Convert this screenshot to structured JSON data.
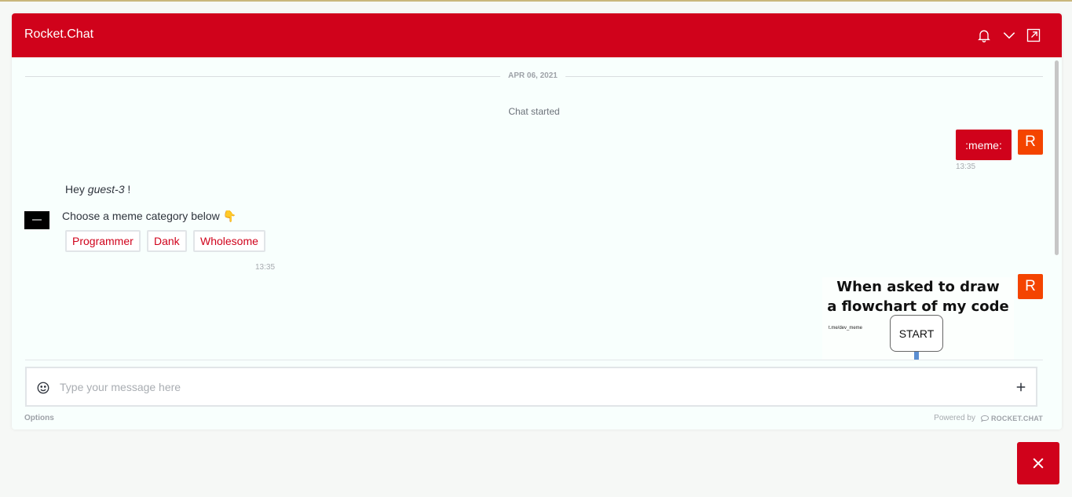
{
  "header": {
    "title": "Rocket.Chat"
  },
  "messages": {
    "date": "APR 06, 2021",
    "system": "Chat started",
    "user_message": {
      "text": ":meme:",
      "time": "13:35",
      "avatar": "R"
    },
    "bot": {
      "greeting_prefix": "Hey ",
      "greeting_name": "guest-3",
      "greeting_suffix": " !",
      "prompt": "Choose a meme category below 👇",
      "quick_replies": [
        "Programmer",
        "Dank",
        "Wholesome"
      ],
      "time": "13:35"
    },
    "meme": {
      "avatar": "R",
      "title_line1": "When asked to draw",
      "title_line2": "a flowchart of my code",
      "credit": "t.me/dev_meme",
      "box_label": "START"
    }
  },
  "composer": {
    "placeholder": "Type your message here"
  },
  "footer": {
    "options": "Options",
    "powered_by": "Powered by",
    "logo_text": "ROCKET.CHAT"
  },
  "colors": {
    "brand": "#d0021b",
    "avatar": "#f44400"
  }
}
